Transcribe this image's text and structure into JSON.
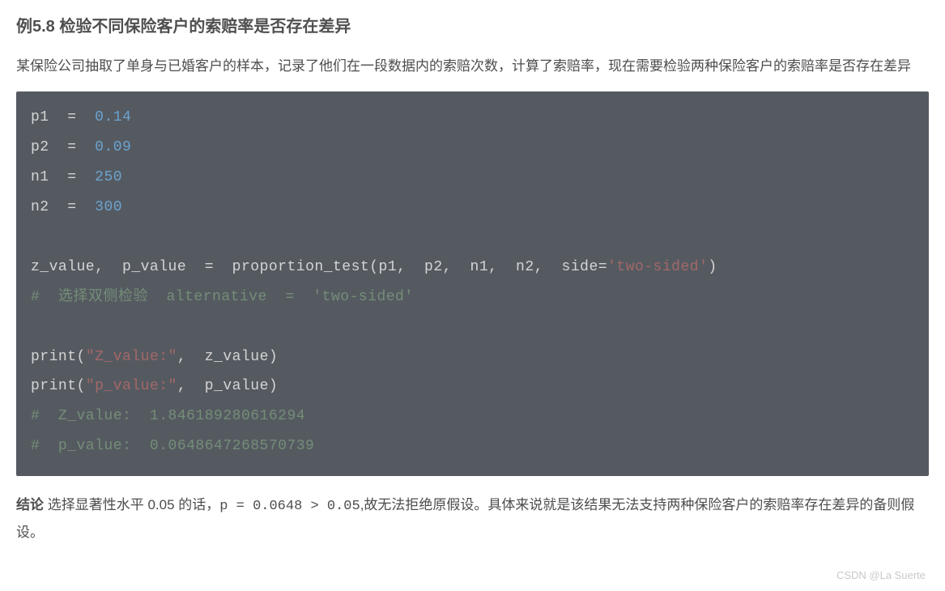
{
  "heading": "例5.8 检验不同保险客户的索赔率是否存在差异",
  "intro": "某保险公司抽取了单身与已婚客户的样本，记录了他们在一段数据内的索赔次数，计算了索赔率，现在需要检验两种保险客户的索赔率是否存在差异",
  "code": {
    "l1": {
      "var": "p1",
      "op": "=",
      "num": "0.14"
    },
    "l2": {
      "var": "p2",
      "op": "=",
      "num": "0.09"
    },
    "l3": {
      "var": "n1",
      "op": "=",
      "num": "250"
    },
    "l4": {
      "var": "n2",
      "op": "=",
      "num": "300"
    },
    "l5": {
      "lhs": "z_value,  p_value",
      "op": "=",
      "func": "proportion_test",
      "args_plain": "p1,  p2,  n1,  n2,  side=",
      "arg_str": "'two-sided'"
    },
    "l6": "#  选择双侧检验  alternative  =  'two-sided'",
    "l7": {
      "func": "print",
      "str": "\"Z_value:\"",
      "rest": ",  z_value"
    },
    "l8": {
      "func": "print",
      "str": "\"p_value:\"",
      "rest": ",  p_value"
    },
    "l9": "#  Z_value:  1.846189280616294",
    "l10": "#  p_value:  0.0648647268570739"
  },
  "conclusion": {
    "bold": "结论",
    "part1": " 选择显著性水平 0.05 的话，",
    "code": "p = 0.0648 > 0.05",
    "part2": ",故无法拒绝原假设。具体来说就是该结果无法支持两种保险客户的索赔率存在差异的备则假设。"
  },
  "watermark": "CSDN @La Suerte"
}
